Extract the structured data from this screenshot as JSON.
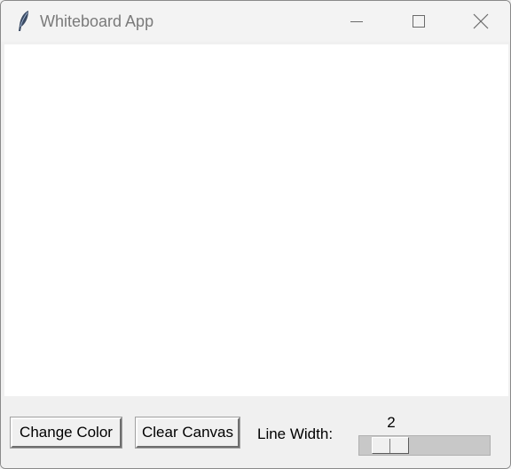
{
  "window": {
    "title": "Whiteboard App",
    "app_icon": "feather-icon"
  },
  "titlebar_controls": {
    "minimize_icon": "minimize-icon",
    "maximize_icon": "maximize-icon",
    "close_icon": "close-icon"
  },
  "canvas": {
    "background": "#ffffff"
  },
  "toolbar": {
    "change_color_label": "Change Color",
    "clear_canvas_label": "Clear Canvas",
    "line_width_label": "Line Width:",
    "line_width_value": "2"
  }
}
